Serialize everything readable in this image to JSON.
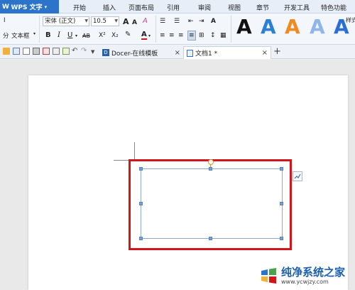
{
  "app": {
    "logo": "W",
    "title": "WPS 文字",
    "caret": "▾"
  },
  "menu": [
    "开始",
    "插入",
    "页面布局",
    "引用",
    "审阅",
    "视图",
    "章节",
    "开发工具",
    "特色功能"
  ],
  "ribbon": {
    "left_stub_1": "I",
    "paste_label": "分",
    "textbox_label": "文本框",
    "font_name": "宋体 (正文)",
    "font_size": "10.5",
    "grow_font": "A",
    "shrink_font": "A",
    "clear_format": "A",
    "bold": "B",
    "italic": "I",
    "underline": "U",
    "strike": "AB",
    "superscript": "X²",
    "subscript": "X₂",
    "font_color": "A",
    "text_effect": "A",
    "effect_samples": [
      "A",
      "A",
      "A",
      "A",
      "A"
    ],
    "effect_colors": [
      "#111111",
      "#2d7fd3",
      "#f08a22",
      "#8eb6e8",
      "#2a6ed6"
    ],
    "right_cut": "样式"
  },
  "tabs": {
    "docer": "Docer-在线模板",
    "doc1": "文档1 *",
    "close": "×",
    "new": "+"
  },
  "watermark": {
    "title": "纯净系统之家",
    "url": "www.ycwjzy.com"
  }
}
